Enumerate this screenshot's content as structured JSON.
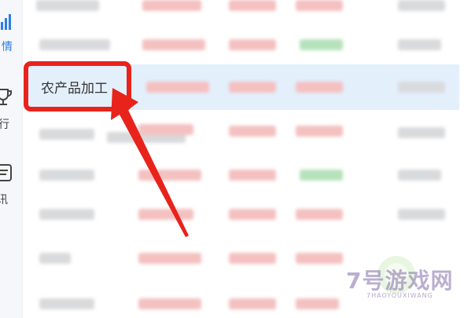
{
  "sidebar": {
    "items": [
      {
        "label": "情",
        "icon": "bar-chart-icon"
      },
      {
        "label": "行",
        "icon": "trophy-icon"
      },
      {
        "label": "讯",
        "icon": "news-icon"
      }
    ]
  },
  "table": {
    "highlighted_row": {
      "label": "农产品加工"
    }
  },
  "watermark": {
    "title": "7号游戏网",
    "subtitle": "7HAOYOUXIWANG"
  },
  "colors": {
    "accent": "#2b7de9",
    "highlight_row": "#e3f0fc",
    "callout": "#e8231c"
  }
}
